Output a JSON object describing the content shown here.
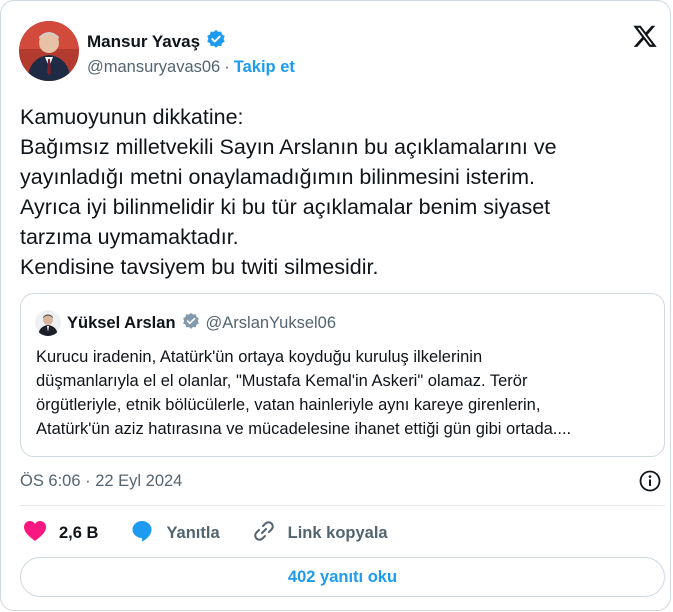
{
  "author": {
    "name": "Mansur Yavaş",
    "handle": "@mansuryavas06",
    "separator": "·",
    "follow_label": "Takip et"
  },
  "tweet": {
    "lines": [
      "Kamuoyunun dikkatine:",
      "Bağımsız milletvekili Sayın Arslanın bu açıklamalarını ve",
      "yayınladığı metni onaylamadığımın bilinmesini isterim.",
      "Ayrıca iyi bilinmelidir ki bu tür açıklamalar benim siyaset",
      "tarzıma uymamaktadır.",
      "Kendisine tavsiyem bu twiti silmesidir."
    ]
  },
  "quoted": {
    "name": "Yüksel Arslan",
    "handle": "@ArslanYuksel06",
    "lines": [
      "Kurucu iradenin, Atatürk'ün ortaya koyduğu kuruluş ilkelerinin",
      "düşmanlarıyla el el olanlar, \"Mustafa Kemal'in Askeri\" olamaz. Terör",
      "örgütleriyle, etnik bölücülerle, vatan hainleriyle aynı kareye girenlerin,",
      "Atatürk'ün aziz hatırasına ve mücadelesine ihanet ettiği gün gibi ortada...."
    ]
  },
  "meta": {
    "timestamp": "ÖS 6:06 · 22 Eyl 2024"
  },
  "actions": {
    "likes": "2,6 B",
    "reply_label": "Yanıtla",
    "copy_link_label": "Link kopyala"
  },
  "read_replies_label": "402 yanıtı oku",
  "colors": {
    "accent": "#1d9bf0",
    "like": "#f91880",
    "text": "#0f1419",
    "muted": "#536471",
    "border": "#cfd9de"
  },
  "icons": [
    "verified-badge-icon",
    "x-logo-icon",
    "info-icon",
    "heart-icon",
    "reply-icon",
    "link-icon"
  ]
}
